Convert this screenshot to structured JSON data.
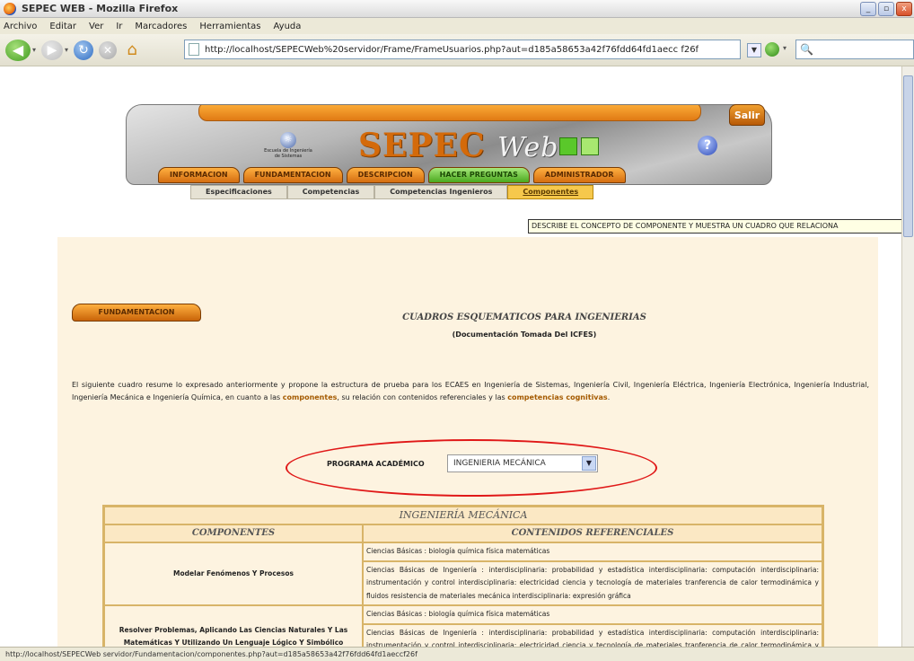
{
  "window": {
    "title": "SEPEC WEB - Mozilla Firefox",
    "controls": [
      "_",
      "▫",
      "x"
    ]
  },
  "menu": [
    "Archivo",
    "Editar",
    "Ver",
    "Ir",
    "Marcadores",
    "Herramientas",
    "Ayuda"
  ],
  "toolbar": {
    "url": "http://localhost/SEPECWeb%20servidor/Frame/FrameUsuarios.php?aut=d185a58653a42f76fdd64fd1aecc f26f",
    "search_icon": "search-icon"
  },
  "header": {
    "brand": "SEPEC",
    "brand_web": "Web",
    "logo_text": "Escuela de Ingeniería de Sistemas",
    "help": "?",
    "exit": "Salir",
    "tabs": [
      "INFORMACION",
      "FUNDAMENTACION",
      "DESCRIPCION",
      "HACER PREGUNTAS",
      "ADMINISTRADOR"
    ],
    "active_tab": 3,
    "subtabs": [
      "Especificaciones",
      "Competencias",
      "Competencias Ingenieros",
      "Componentes"
    ],
    "active_subtab": 3
  },
  "tooltip": "DESCRIBE EL CONCEPTO DE COMPONENTE Y MUESTRA UN CUADRO QUE RELACIONA",
  "content": {
    "section_button": "FUNDAMENTACION",
    "title": "CUADROS ESQUEMATICOS PARA INGENIERIAS",
    "doc_note": "(Documentación Tomada Del ICFES)",
    "intro_a": "El siguiente cuadro resume lo expresado anteriormente y propone la estructura de prueba para los ECAES en Ingeniería de Sistemas, Ingeniería Civil, Ingeniería Eléctrica, Ingeniería Electrónica, Ingeniería Industrial, Ingeniería Mecánica e Ingeniería Química, en cuanto a las ",
    "intro_hl1": "componentes",
    "intro_b": ", su relación con contenidos referenciales y las ",
    "intro_hl2": "competencias cognitivas",
    "intro_c": ".",
    "program_label": "PROGRAMA ACADÉMICO",
    "program_value": "INGENIERIA MECÁNICA",
    "accent_color": "#e01818"
  },
  "table": {
    "caption": "INGENIERÍA MECÁNICA",
    "headers": [
      "COMPONENTES",
      "CONTENIDOS REFERENCIALES"
    ],
    "rows": [
      {
        "component": "Modelar Fenómenos Y Procesos",
        "contents": [
          "Ciencias Básicas : biología química física matemáticas",
          "Ciencias Básicas de Ingeniería : interdisciplinaria: probabilidad y estadística interdisciplinaria: computación interdisciplinaria: instrumentación y control interdisciplinaria: electricidad ciencia y tecnología de materiales tranferencia de calor termodinámica y fluidos resistencia de materiales mecánica interdisciplinaria: expresión gráfica"
        ]
      },
      {
        "component": "Resolver Problemas, Aplicando Las Ciencias Naturales Y Las Matemáticas Y Utilizando Un Lenguaje Lógico Y Simbólico",
        "contents": [
          "Ciencias Básicas : biología química física matemáticas",
          "Ciencias Básicas de Ingeniería : interdisciplinaria: probabilidad y estadística interdisciplinaria: computación interdisciplinaria: instrumentación y control interdisciplinaria: electricidad ciencia y tecnología de materiales tranferencia de calor termodinámica y fluidos resistencia de materiales"
        ]
      }
    ]
  },
  "status": "http://localhost/SEPECWeb servidor/Fundamentacion/componentes.php?aut=d185a58653a42f76fdd64fd1aeccf26f"
}
